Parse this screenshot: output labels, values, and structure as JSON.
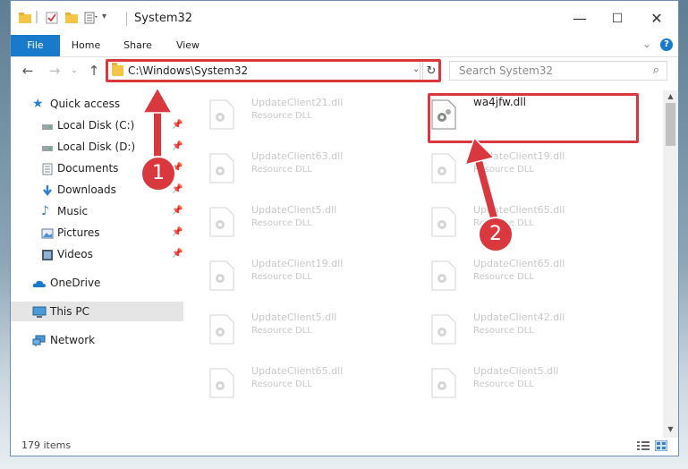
{
  "window": {
    "title": "System32"
  },
  "ribbon": {
    "tabs": [
      "File",
      "Home",
      "Share",
      "View"
    ]
  },
  "address": {
    "path": "C:\\Windows\\System32"
  },
  "search": {
    "placeholder": "Search System32"
  },
  "nav": {
    "quick_access": "Quick access",
    "items": [
      {
        "label": "Local Disk (C:)",
        "icon": "drive-icon",
        "pinned": true
      },
      {
        "label": "Local Disk (D:)",
        "icon": "drive-icon",
        "pinned": true
      },
      {
        "label": "Documents",
        "icon": "documents-icon",
        "pinned": true
      },
      {
        "label": "Downloads",
        "icon": "downloads-icon",
        "pinned": true
      },
      {
        "label": "Music",
        "icon": "music-icon",
        "pinned": true
      },
      {
        "label": "Pictures",
        "icon": "pictures-icon",
        "pinned": true
      },
      {
        "label": "Videos",
        "icon": "videos-icon",
        "pinned": true
      }
    ],
    "onedrive": "OneDrive",
    "this_pc": "This PC",
    "network": "Network"
  },
  "files": {
    "col1": [
      {
        "name": "UpdateClient21.dll",
        "type": "Resource DLL"
      },
      {
        "name": "UpdateClient63.dll",
        "type": "Resource DLL"
      },
      {
        "name": "UpdateClient5.dll",
        "type": "Resource DLL"
      },
      {
        "name": "UpdateClient19.dll",
        "type": "Resource DLL"
      },
      {
        "name": "UpdateClient5.dll",
        "type": "Resource DLL"
      },
      {
        "name": "UpdateClient65.dll",
        "type": "Resource DLL"
      }
    ],
    "col2": [
      {
        "name": "wa4jfw.dll",
        "type": ""
      },
      {
        "name": "UpdateClient19.dll",
        "type": "Resource DLL"
      },
      {
        "name": "UpdateClient65.dll",
        "type": "Resource DLL"
      },
      {
        "name": "UpdateClient65.dll",
        "type": "Resource DLL"
      },
      {
        "name": "UpdateClient42.dll",
        "type": "Resource DLL"
      },
      {
        "name": "UpdateClient5.dll",
        "type": "Resource DLL"
      }
    ]
  },
  "status": {
    "count": "179 items"
  },
  "annotations": {
    "step1": "1",
    "step2": "2",
    "color": "#d9383f"
  }
}
